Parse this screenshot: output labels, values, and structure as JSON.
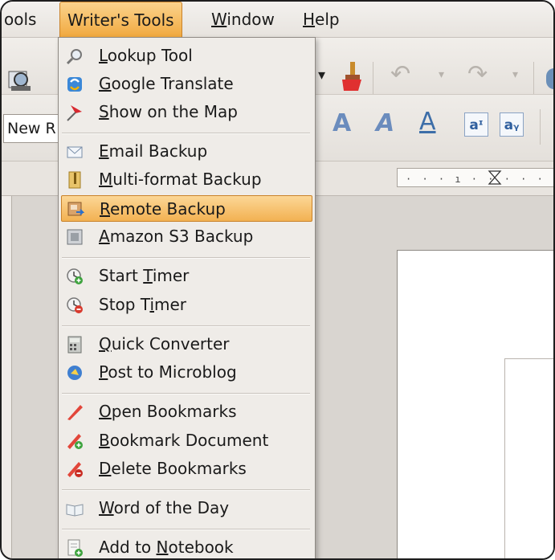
{
  "menubar": {
    "items": [
      {
        "label": "ools",
        "ul": ""
      },
      {
        "label": "Writer's Tools",
        "ul": ""
      },
      {
        "pre": "",
        "ul": "W",
        "post": "indow"
      },
      {
        "pre": "",
        "ul": "H",
        "post": "elp"
      }
    ]
  },
  "toolbar": {
    "font_name": "New R"
  },
  "ruler": {
    "ticks": "· · · ı · · · · ·"
  },
  "menu": {
    "items": [
      {
        "pre": "",
        "ul": "L",
        "post": "ookup Tool",
        "icon": "magnifier-icon"
      },
      {
        "pre": "",
        "ul": "G",
        "post": "oogle Translate",
        "icon": "translate-icon"
      },
      {
        "pre": "",
        "ul": "S",
        "post": "how on the Map",
        "icon": "map-pin-icon"
      },
      {
        "pre": "",
        "ul": "E",
        "post": "mail Backup",
        "icon": "email-icon"
      },
      {
        "pre": "",
        "ul": "M",
        "post": "ulti-format Backup",
        "icon": "zip-icon"
      },
      {
        "pre": "",
        "ul": "R",
        "post": "emote Backup",
        "icon": "remote-backup-icon"
      },
      {
        "pre": "",
        "ul": "A",
        "post": "mazon S3 Backup",
        "icon": "s3-icon"
      },
      {
        "pre": "Start ",
        "ul": "T",
        "post": "imer",
        "icon": "timer-start-icon"
      },
      {
        "pre": "Stop T",
        "ul": "i",
        "post": "mer",
        "icon": "timer-stop-icon"
      },
      {
        "pre": "",
        "ul": "Q",
        "post": "uick Converter",
        "icon": "calculator-icon"
      },
      {
        "pre": "",
        "ul": "P",
        "post": "ost to Microblog",
        "icon": "microblog-icon"
      },
      {
        "pre": "",
        "ul": "O",
        "post": "pen Bookmarks",
        "icon": "bookmark-icon"
      },
      {
        "pre": "",
        "ul": "B",
        "post": "ookmark Document",
        "icon": "bookmark-add-icon"
      },
      {
        "pre": "",
        "ul": "D",
        "post": "elete Bookmarks",
        "icon": "bookmark-delete-icon"
      },
      {
        "pre": "",
        "ul": "W",
        "post": "ord of the Day",
        "icon": "book-icon"
      },
      {
        "pre": "Add to ",
        "ul": "N",
        "post": "otebook",
        "icon": "notebook-icon"
      }
    ],
    "highlighted_index": 5
  },
  "colors": {
    "highlight": "#f2b152",
    "menu_bg": "#efece8"
  }
}
